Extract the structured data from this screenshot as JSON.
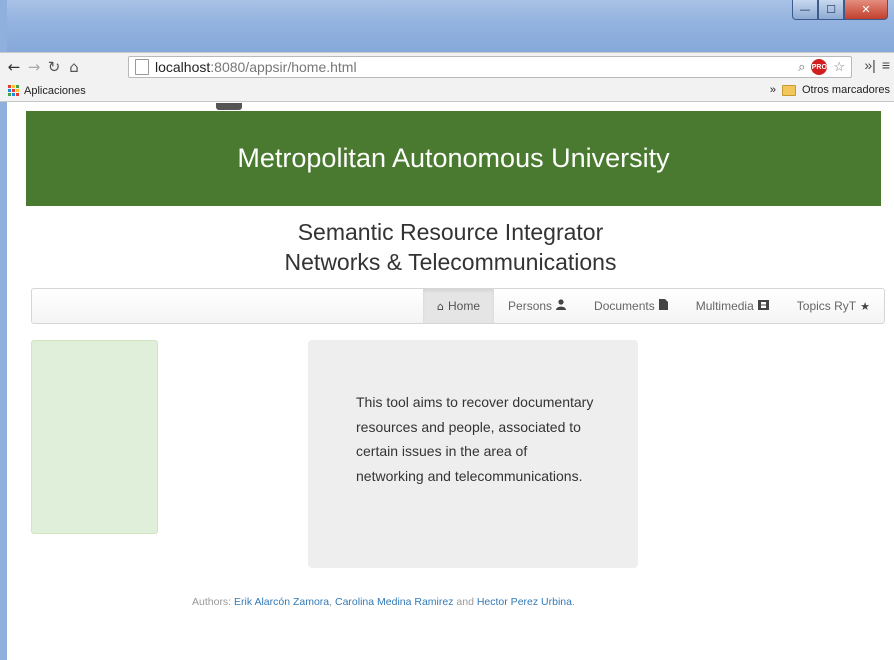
{
  "browser": {
    "url_host": "localhost",
    "url_rest": ":8080/appsir/home.html",
    "bookmarks_label": "Aplicaciones",
    "more_bookmarks": "»",
    "other_bookmarks": "Otros marcadores",
    "extension_badge": "PRO",
    "icons": [
      "back-icon",
      "forward-icon",
      "reload-icon",
      "home-icon",
      "page-icon",
      "zoom-icon",
      "star-icon",
      "menu-icon",
      "folder-icon",
      "apps-icon"
    ]
  },
  "header": {
    "banner_title": "Metropolitan Autonomous University",
    "subtitle_line1": "Semantic Resource Integrator",
    "subtitle_line2": "Networks & Telecommunications"
  },
  "navbar": {
    "items": [
      {
        "label": "Home",
        "icon": "home-icon",
        "glyph": "⌂",
        "active": true
      },
      {
        "label": "Persons",
        "icon": "user-icon",
        "glyph": "👤"
      },
      {
        "label": "Documents",
        "icon": "file-icon",
        "glyph": "▮"
      },
      {
        "label": "Multimedia",
        "icon": "film-icon",
        "glyph": "▤"
      },
      {
        "label": "Topics RyT",
        "icon": "star-icon",
        "glyph": "★"
      }
    ]
  },
  "main": {
    "description": "This tool aims to recover documentary resources and people, associated to certain issues in the area of networking and telecommunications."
  },
  "footer": {
    "prefix": "Authors:",
    "author1": "Erik Alarcón Zamora",
    "sep1": ",",
    "author2": "Carolina Medina Ramirez",
    "and": "and",
    "author3": "Hector Perez Urbina",
    "end": "."
  },
  "colors": {
    "banner_bg": "#4a7a2f",
    "sidebar_bg": "#dfefd9",
    "info_bg": "#eeeeee",
    "link": "#337ab7"
  }
}
